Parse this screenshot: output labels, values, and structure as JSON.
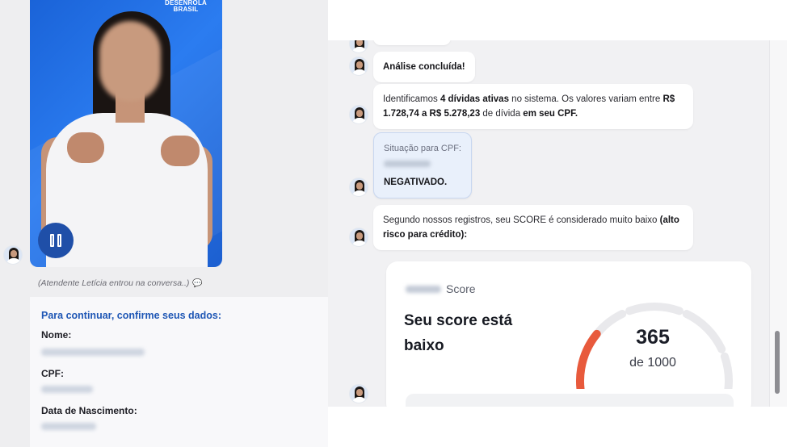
{
  "video": {
    "brand_line1": "DESENROLA",
    "brand_line2": "BRASIL",
    "pause_icon": "pause-icon"
  },
  "system_message": "(Atendente Letícia entrou na conversa..)",
  "confirm_card": {
    "title": "Para continuar, confirme seus dados:",
    "name_label": "Nome:",
    "cpf_label": "CPF:",
    "birth_label": "Data de Nascimento:"
  },
  "chat": {
    "analysis_done": "Análise concluída!",
    "debts": {
      "part1": "Identificamos ",
      "bold1": "4 dívidas ativas",
      "part2": " no sistema. Os valores variam entre ",
      "bold2": "R$ 1.728,74 a R$ 5.278,23",
      "part3": " de dívida ",
      "bold3": "em seu CPF."
    },
    "status": {
      "label": "Situação para CPF:",
      "value": "NEGATIVADO."
    },
    "score_msg": {
      "part1": "Segundo nossos registros, seu SCORE é considerado muito baixo ",
      "bold1": "(alto risco para crédito):"
    }
  },
  "score_card": {
    "brand_suffix": "Score",
    "headline": "Seu score está baixo",
    "value": "365",
    "out_of": "de 1000",
    "score": 365,
    "max": 1000,
    "colors": {
      "low": "#e85a3c",
      "track": "#e9e9ec"
    }
  }
}
